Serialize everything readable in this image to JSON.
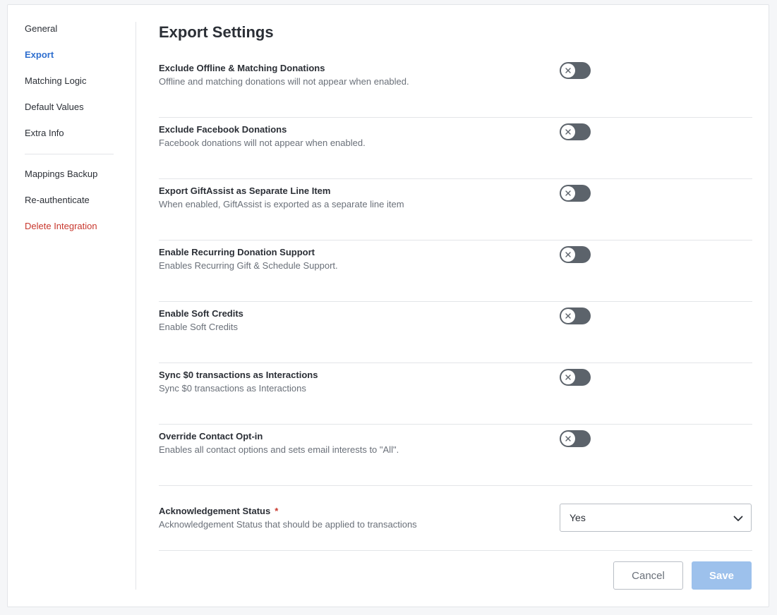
{
  "sidebar": {
    "items_top": [
      {
        "label": "General"
      },
      {
        "label": "Export"
      },
      {
        "label": "Matching Logic"
      },
      {
        "label": "Default Values"
      },
      {
        "label": "Extra Info"
      }
    ],
    "items_bottom": [
      {
        "label": "Mappings Backup"
      },
      {
        "label": "Re-authenticate"
      },
      {
        "label": "Delete Integration"
      }
    ],
    "active": "Export"
  },
  "main": {
    "title": "Export Settings",
    "settings": [
      {
        "title": "Exclude Offline & Matching Donations",
        "description": "Offline and matching donations will not appear when enabled.",
        "enabled": false
      },
      {
        "title": "Exclude Facebook Donations",
        "description": "Facebook donations will not appear when enabled.",
        "enabled": false
      },
      {
        "title": "Export GiftAssist as Separate Line Item",
        "description": "When enabled, GiftAssist is exported as a separate line item",
        "enabled": false
      },
      {
        "title": "Enable Recurring Donation Support",
        "description": "Enables Recurring Gift & Schedule Support.",
        "enabled": false
      },
      {
        "title": "Enable Soft Credits",
        "description": "Enable Soft Credits",
        "enabled": false
      },
      {
        "title": "Sync $0 transactions as Interactions",
        "description": "Sync $0 transactions as Interactions",
        "enabled": false
      },
      {
        "title": "Override Contact Opt-in",
        "description": "Enables all contact options and sets email interests to \"All\".",
        "enabled": false
      }
    ],
    "acknowledgement": {
      "title": "Acknowledgement Status",
      "required_mark": "*",
      "description": "Acknowledgement Status that should be applied to transactions",
      "value": "Yes"
    }
  },
  "buttons": {
    "cancel": "Cancel",
    "save": "Save"
  },
  "colors": {
    "accent": "#2f6fcf",
    "danger": "#c8372d",
    "toggle_off": "#5c636b",
    "save_disabled": "#9dc1ec"
  }
}
